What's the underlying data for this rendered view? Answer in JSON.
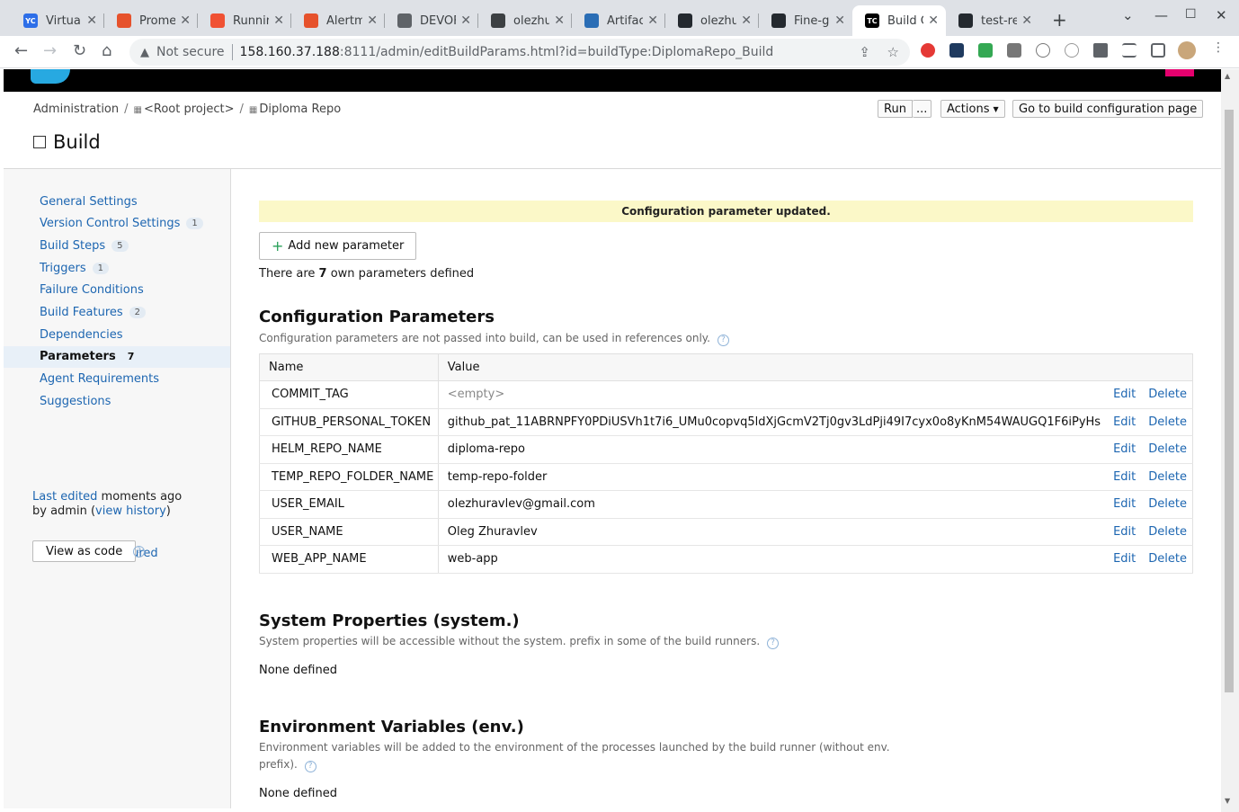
{
  "browser": {
    "tabs": [
      {
        "title": "Virtual",
        "color": "#2d6ee8",
        "glyph": "YC"
      },
      {
        "title": "Prome",
        "color": "#e6522c",
        "glyph": ""
      },
      {
        "title": "Runnin",
        "color": "#f05133",
        "glyph": ""
      },
      {
        "title": "Alertm",
        "color": "#e6522c",
        "glyph": ""
      },
      {
        "title": "DEVOF",
        "color": "#5f6368",
        "glyph": ""
      },
      {
        "title": "olezhu",
        "color": "#3c4043",
        "glyph": ""
      },
      {
        "title": "Artifac",
        "color": "#2a6db5",
        "glyph": ""
      },
      {
        "title": "olezhu",
        "color": "#24292f",
        "glyph": ""
      },
      {
        "title": "Fine-g",
        "color": "#24292f",
        "glyph": ""
      },
      {
        "title": "Build C",
        "color": "#000000",
        "glyph": "TC",
        "active": true
      },
      {
        "title": "test-re",
        "color": "#24292f",
        "glyph": ""
      }
    ],
    "security_label": "Not secure",
    "url_host": "158.160.37.188",
    "url_path": ":8111/admin/editBuildParams.html?id=buildType:DiplomaRepo_Build"
  },
  "breadcrumb": {
    "admin": "Administration",
    "root": "<Root project>",
    "project": "Diploma Repo"
  },
  "page_title": "Build",
  "header_buttons": {
    "run": "Run",
    "more": "...",
    "actions": "Actions",
    "goto": "Go to build configuration page"
  },
  "sidebar": {
    "items": [
      {
        "label": "General Settings",
        "badge": ""
      },
      {
        "label": "Version Control Settings",
        "badge": "1"
      },
      {
        "label": "Build Steps",
        "badge": "5"
      },
      {
        "label": "Triggers",
        "badge": "1"
      },
      {
        "label": "Failure Conditions",
        "badge": ""
      },
      {
        "label": "Build Features",
        "badge": "2"
      },
      {
        "label": "Dependencies",
        "badge": ""
      },
      {
        "label": "Parameters",
        "badge": "7",
        "selected": true
      },
      {
        "label": "Agent Requirements",
        "badge": ""
      },
      {
        "label": "Suggestions",
        "badge": ""
      }
    ],
    "hide_unconfigured": "« Hide unconfigured",
    "last_edited_link": "Last edited",
    "last_edited_time": " moments ago",
    "by_prefix": "by admin  (",
    "view_history": "view history",
    "by_suffix": ")",
    "view_as_code": "View as code"
  },
  "notice": "Configuration parameter updated.",
  "add_parameter": "Add new parameter",
  "count_prefix": "There are ",
  "count_value": "7",
  "count_suffix": " own parameters defined",
  "config_params": {
    "heading": "Configuration Parameters",
    "description": "Configuration parameters are not passed into build, can be used in references only.",
    "col_name": "Name",
    "col_value": "Value",
    "edit_label": "Edit",
    "delete_label": "Delete",
    "rows": [
      {
        "name": "COMMIT_TAG",
        "value": "<empty>",
        "empty": true
      },
      {
        "name": "GITHUB_PERSONAL_TOKEN",
        "value": "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"
      },
      {
        "name": "HELM_REPO_NAME",
        "value": "diploma-repo"
      },
      {
        "name": "TEMP_REPO_FOLDER_NAME",
        "value": "temp-repo-folder"
      },
      {
        "name": "USER_EMAIL",
        "value": "olezhuravlev@gmail.com"
      },
      {
        "name": "USER_NAME",
        "value": "Oleg Zhuravlev"
      },
      {
        "name": "WEB_APP_NAME",
        "value": "web-app"
      }
    ]
  },
  "system_props": {
    "heading": "System Properties (system.)",
    "description": "System properties will be accessible without the system. prefix in some of the build runners.",
    "none": "None defined"
  },
  "env_vars": {
    "heading": "Environment Variables (env.)",
    "description_line1": "Environment variables will be added to the environment of the processes launched by the build runner (without env.",
    "description_line2": "prefix).",
    "none": "None defined"
  }
}
